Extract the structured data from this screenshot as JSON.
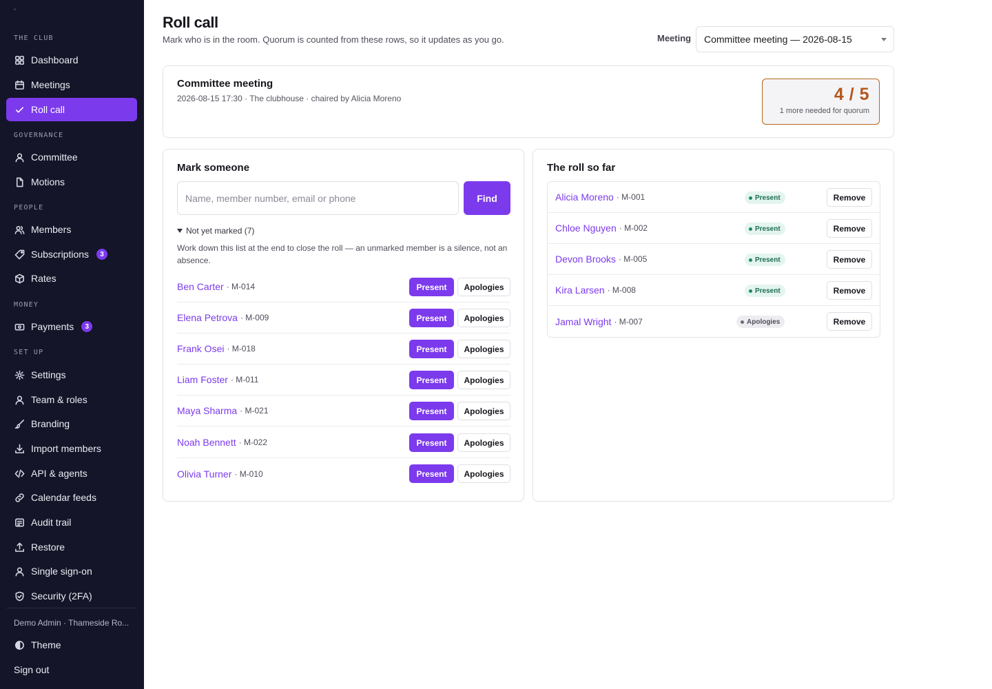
{
  "sidebar": {
    "sections": {
      "club": "The club",
      "governance": "Governance",
      "people": "People",
      "money": "Money",
      "setup": "Set up"
    },
    "items": [
      {
        "label": "Dashboard",
        "icon": "grid-icon"
      },
      {
        "label": "Meetings",
        "icon": "calendar-icon"
      },
      {
        "label": "Roll call",
        "icon": "check-icon",
        "active": true
      },
      {
        "label": "Committee",
        "icon": "user-icon"
      },
      {
        "label": "Motions",
        "icon": "document-icon"
      },
      {
        "label": "Members",
        "icon": "users-icon"
      },
      {
        "label": "Subscriptions",
        "icon": "tag-icon",
        "badge": "3"
      },
      {
        "label": "Rates",
        "icon": "box-icon"
      },
      {
        "label": "Payments",
        "icon": "banknote-icon",
        "badge": "3"
      },
      {
        "label": "Settings",
        "icon": "gear-icon"
      },
      {
        "label": "Team & roles",
        "icon": "user-icon"
      },
      {
        "label": "Branding",
        "icon": "brush-icon"
      },
      {
        "label": "Import members",
        "icon": "download-icon"
      },
      {
        "label": "API & agents",
        "icon": "code-icon"
      },
      {
        "label": "Calendar feeds",
        "icon": "link-icon"
      },
      {
        "label": "Audit trail",
        "icon": "list-icon"
      },
      {
        "label": "Restore",
        "icon": "upload-icon"
      },
      {
        "label": "Single sign-on",
        "icon": "user-icon"
      },
      {
        "label": "Security (2FA)",
        "icon": "shield-icon"
      }
    ],
    "user": "Demo Admin · Thameside Ro...",
    "theme_label": "Theme",
    "signout_label": "Sign out"
  },
  "header": {
    "title": "Roll call",
    "subtitle": "Mark who is in the room. Quorum is counted from these rows, so it updates as you go.",
    "meeting_label": "Meeting",
    "meeting_selected": "Committee meeting — 2026-08-15"
  },
  "meeting_card": {
    "title": "Committee meeting",
    "meta": "2026-08-15 17:30 · The clubhouse · chaired by Alicia Moreno",
    "quorum_count": "4 / 5",
    "quorum_note": "1 more needed for quorum"
  },
  "mark": {
    "heading": "Mark someone",
    "search_placeholder": "Name, member number, email or phone",
    "find_label": "Find",
    "unmarked_toggle": "Not yet marked (7)",
    "help": "Work down this list at the end to close the roll — an unmarked member is a silence, not an absence.",
    "present_label": "Present",
    "apologies_label": "Apologies",
    "rows": [
      {
        "name": "Ben Carter",
        "num": "· M-014"
      },
      {
        "name": "Elena Petrova",
        "num": "· M-009"
      },
      {
        "name": "Frank Osei",
        "num": "· M-018"
      },
      {
        "name": "Liam Foster",
        "num": "· M-011"
      },
      {
        "name": "Maya Sharma",
        "num": "· M-021"
      },
      {
        "name": "Noah Bennett",
        "num": "· M-022"
      },
      {
        "name": "Olivia Turner",
        "num": "· M-010"
      }
    ]
  },
  "roll": {
    "heading": "The roll so far",
    "remove_label": "Remove",
    "rows": [
      {
        "name": "Alicia Moreno",
        "num": "· M-001",
        "status": "Present"
      },
      {
        "name": "Chloe Nguyen",
        "num": "· M-002",
        "status": "Present"
      },
      {
        "name": "Devon Brooks",
        "num": "· M-005",
        "status": "Present"
      },
      {
        "name": "Kira Larsen",
        "num": "· M-008",
        "status": "Present"
      },
      {
        "name": "Jamal Wright",
        "num": "· M-007",
        "status": "Apologies"
      }
    ]
  },
  "colors": {
    "sidebar_bg": "#141528",
    "accent": "#7c3aed",
    "quorum": "#b5561d",
    "present_pill": "#e3f5ee",
    "apologies_pill": "#ededf1"
  }
}
